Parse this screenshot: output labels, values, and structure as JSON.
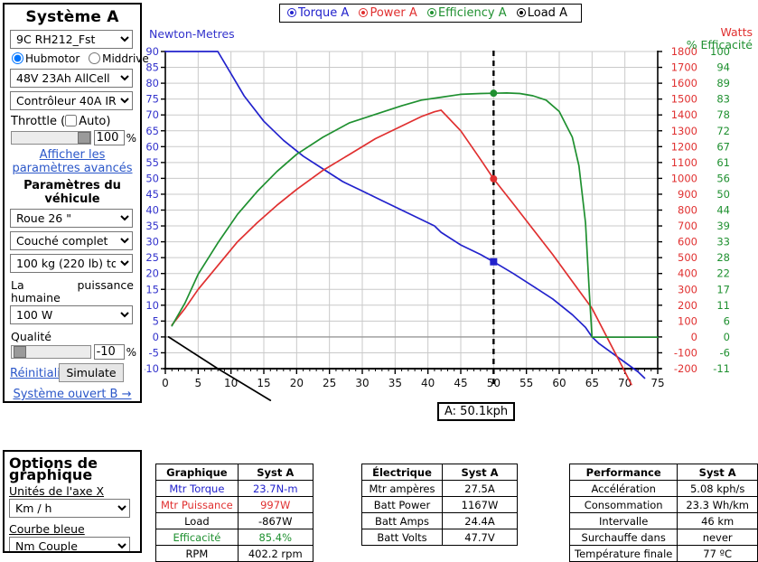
{
  "sidebar": {
    "title": "Système A",
    "motor_select": "9C RH212_Fst",
    "drive_options": {
      "hubmotor": "Hubmotor",
      "middrive": "Middrive"
    },
    "battery_select": "48V 23Ah AllCell",
    "controller_select": "Contrôleur 40A IR",
    "throttle_label": "Throttle (",
    "throttle_auto": "Auto)",
    "throttle_value": "100",
    "throttle_unit": "%",
    "advanced_link_l1": "Afficher les",
    "advanced_link_l2": "paramètres avancés",
    "vehicle_title_l1": "Paramètres du",
    "vehicle_title_l2": "véhicule",
    "wheel_select": "Roue 26 \"",
    "position_select": "Couché complet",
    "weight_select": "100 kg (220 lb) tot",
    "human_power_l1": "La",
    "human_power_l2": "puissance",
    "human_power_l3": "humaine",
    "human_power_select": "100 W",
    "quality_label": "Qualité",
    "quality_value": "-10",
    "quality_unit": "%",
    "reset_link": "Réinitialiser",
    "simulate_button": "Simulate",
    "system_b_link": "Système ouvert B →"
  },
  "options": {
    "title_l1": "Options de",
    "title_l2": "graphique",
    "x_axis_label": "Unités de l'axe X",
    "x_axis_value": "Km / h",
    "blue_curve_label": "Courbe bleue",
    "blue_curve_value": "Nm Couple"
  },
  "legend": {
    "items": [
      {
        "label": "Torque A",
        "color": "#2222cc"
      },
      {
        "label": "Power A",
        "color": "#e03030"
      },
      {
        "label": "Efficiency A",
        "color": "#1f9030"
      },
      {
        "label": "Load A",
        "color": "#000000"
      }
    ]
  },
  "chart_data": {
    "type": "line",
    "title": "",
    "xlabel": "",
    "axis_captions": {
      "left": "Newton-Metres",
      "right_top": "Watts",
      "right_bottom": "% Efficacité"
    },
    "xlim": [
      0,
      75
    ],
    "xticks": [
      0,
      5,
      10,
      15,
      20,
      25,
      30,
      35,
      40,
      45,
      50,
      55,
      60,
      65,
      70,
      75
    ],
    "y_left": {
      "label": "Newton-Metres",
      "color": "#3333cc",
      "lim": [
        -10,
        90
      ],
      "ticks": [
        90,
        85,
        80,
        75,
        70,
        65,
        60,
        55,
        50,
        45,
        40,
        35,
        30,
        25,
        20,
        15,
        10,
        5,
        0,
        -5,
        -10
      ]
    },
    "y_right_watts": {
      "label": "Watts",
      "color": "#e03030",
      "lim": [
        -200,
        1800
      ],
      "ticks": [
        1800,
        1700,
        1600,
        1500,
        1400,
        1300,
        1200,
        1100,
        1000,
        900,
        800,
        700,
        600,
        500,
        400,
        300,
        200,
        100,
        0,
        -100,
        -200
      ]
    },
    "y_right_eff": {
      "label": "% Efficacité",
      "color": "#1f9030",
      "lim": [
        -11,
        100
      ],
      "ticks": [
        100,
        94,
        89,
        83,
        78,
        72,
        67,
        61,
        56,
        50,
        44,
        39,
        33,
        28,
        22,
        17,
        11,
        6,
        0,
        -6,
        -11
      ]
    },
    "marker": {
      "x": 50,
      "label": "A: 50.1kph",
      "torque": 23.7,
      "power": 997,
      "efficiency": 85.4
    },
    "series": [
      {
        "name": "Torque A",
        "color": "#2222cc",
        "axis": "left",
        "points": [
          [
            0,
            90
          ],
          [
            4,
            90
          ],
          [
            8,
            90
          ],
          [
            10,
            83
          ],
          [
            12,
            76
          ],
          [
            15,
            68
          ],
          [
            18,
            62
          ],
          [
            21,
            57
          ],
          [
            24,
            53
          ],
          [
            27,
            49
          ],
          [
            30,
            46
          ],
          [
            33,
            43
          ],
          [
            36,
            40
          ],
          [
            39,
            37
          ],
          [
            41,
            35
          ],
          [
            42,
            33
          ],
          [
            45,
            29
          ],
          [
            48,
            26
          ],
          [
            50,
            23.7
          ],
          [
            53,
            20
          ],
          [
            56,
            16
          ],
          [
            59,
            12
          ],
          [
            62,
            7
          ],
          [
            64,
            3
          ],
          [
            65,
            0
          ],
          [
            66,
            -2
          ],
          [
            68,
            -5
          ],
          [
            70,
            -8
          ],
          [
            72,
            -11
          ],
          [
            73,
            -13
          ]
        ]
      },
      {
        "name": "Power A",
        "color": "#e03030",
        "axis": "watts",
        "points": [
          [
            1,
            75
          ],
          [
            3,
            180
          ],
          [
            5,
            300
          ],
          [
            8,
            450
          ],
          [
            11,
            600
          ],
          [
            14,
            720
          ],
          [
            17,
            830
          ],
          [
            20,
            930
          ],
          [
            24,
            1050
          ],
          [
            28,
            1150
          ],
          [
            32,
            1250
          ],
          [
            36,
            1330
          ],
          [
            39,
            1390
          ],
          [
            41,
            1420
          ],
          [
            42,
            1430
          ],
          [
            45,
            1300
          ],
          [
            48,
            1120
          ],
          [
            50,
            997
          ],
          [
            53,
            840
          ],
          [
            56,
            680
          ],
          [
            59,
            520
          ],
          [
            62,
            350
          ],
          [
            65,
            180
          ],
          [
            66,
            100
          ],
          [
            68,
            -60
          ],
          [
            70,
            -220
          ],
          [
            71,
            -300
          ]
        ]
      },
      {
        "name": "Efficiency A",
        "color": "#1f9030",
        "axis": "eff",
        "points": [
          [
            1,
            4
          ],
          [
            3,
            12
          ],
          [
            5,
            22
          ],
          [
            8,
            33
          ],
          [
            11,
            43
          ],
          [
            14,
            51
          ],
          [
            17,
            58
          ],
          [
            20,
            64
          ],
          [
            24,
            70
          ],
          [
            28,
            75
          ],
          [
            32,
            78
          ],
          [
            36,
            81
          ],
          [
            39,
            83
          ],
          [
            42,
            84
          ],
          [
            45,
            85
          ],
          [
            48,
            85.3
          ],
          [
            50,
            85.4
          ],
          [
            52,
            85.5
          ],
          [
            54,
            85.3
          ],
          [
            56,
            84.5
          ],
          [
            58,
            83
          ],
          [
            60,
            79
          ],
          [
            62,
            70
          ],
          [
            63,
            60
          ],
          [
            64,
            40
          ],
          [
            64.6,
            15
          ],
          [
            65,
            0
          ],
          [
            68,
            0
          ],
          [
            72,
            0
          ],
          [
            75,
            0
          ]
        ]
      },
      {
        "name": "Load A",
        "color": "#000000",
        "axis": "left",
        "points": [
          [
            0.5,
            0
          ],
          [
            8,
            -10
          ],
          [
            16,
            -20
          ]
        ]
      }
    ]
  },
  "marker_label": "A: 50.1kph",
  "tables": {
    "graph": {
      "header": [
        "Graphique",
        "Syst A"
      ],
      "rows": [
        {
          "label": "Mtr Torque",
          "value": "23.7N-m",
          "color": "#2222cc"
        },
        {
          "label": "Mtr Puissance",
          "value": "997W",
          "color": "#e03030"
        },
        {
          "label": "Load",
          "value": "-867W",
          "color": "#000000"
        },
        {
          "label": "Efficacité",
          "value": "85.4%",
          "color": "#1f9030"
        },
        {
          "label": "RPM",
          "value": "402.2 rpm",
          "color": "#000000"
        }
      ]
    },
    "electric": {
      "header": [
        "Électrique",
        "Syst A"
      ],
      "rows": [
        {
          "label": "Mtr ampères",
          "value": "27.5A"
        },
        {
          "label": "Batt Power",
          "value": "1167W"
        },
        {
          "label": "Batt Amps",
          "value": "24.4A"
        },
        {
          "label": "Batt Volts",
          "value": "47.7V"
        }
      ]
    },
    "performance": {
      "header": [
        "Performance",
        "Syst A"
      ],
      "rows": [
        {
          "label": "Accélération",
          "value": "5.08 kph/s"
        },
        {
          "label": "Consommation",
          "value": "23.3 Wh/km"
        },
        {
          "label": "Intervalle",
          "value": "46 km"
        },
        {
          "label": "Surchauffe dans",
          "value": "never"
        },
        {
          "label": "Température finale",
          "value": "77 ºC"
        }
      ]
    }
  }
}
